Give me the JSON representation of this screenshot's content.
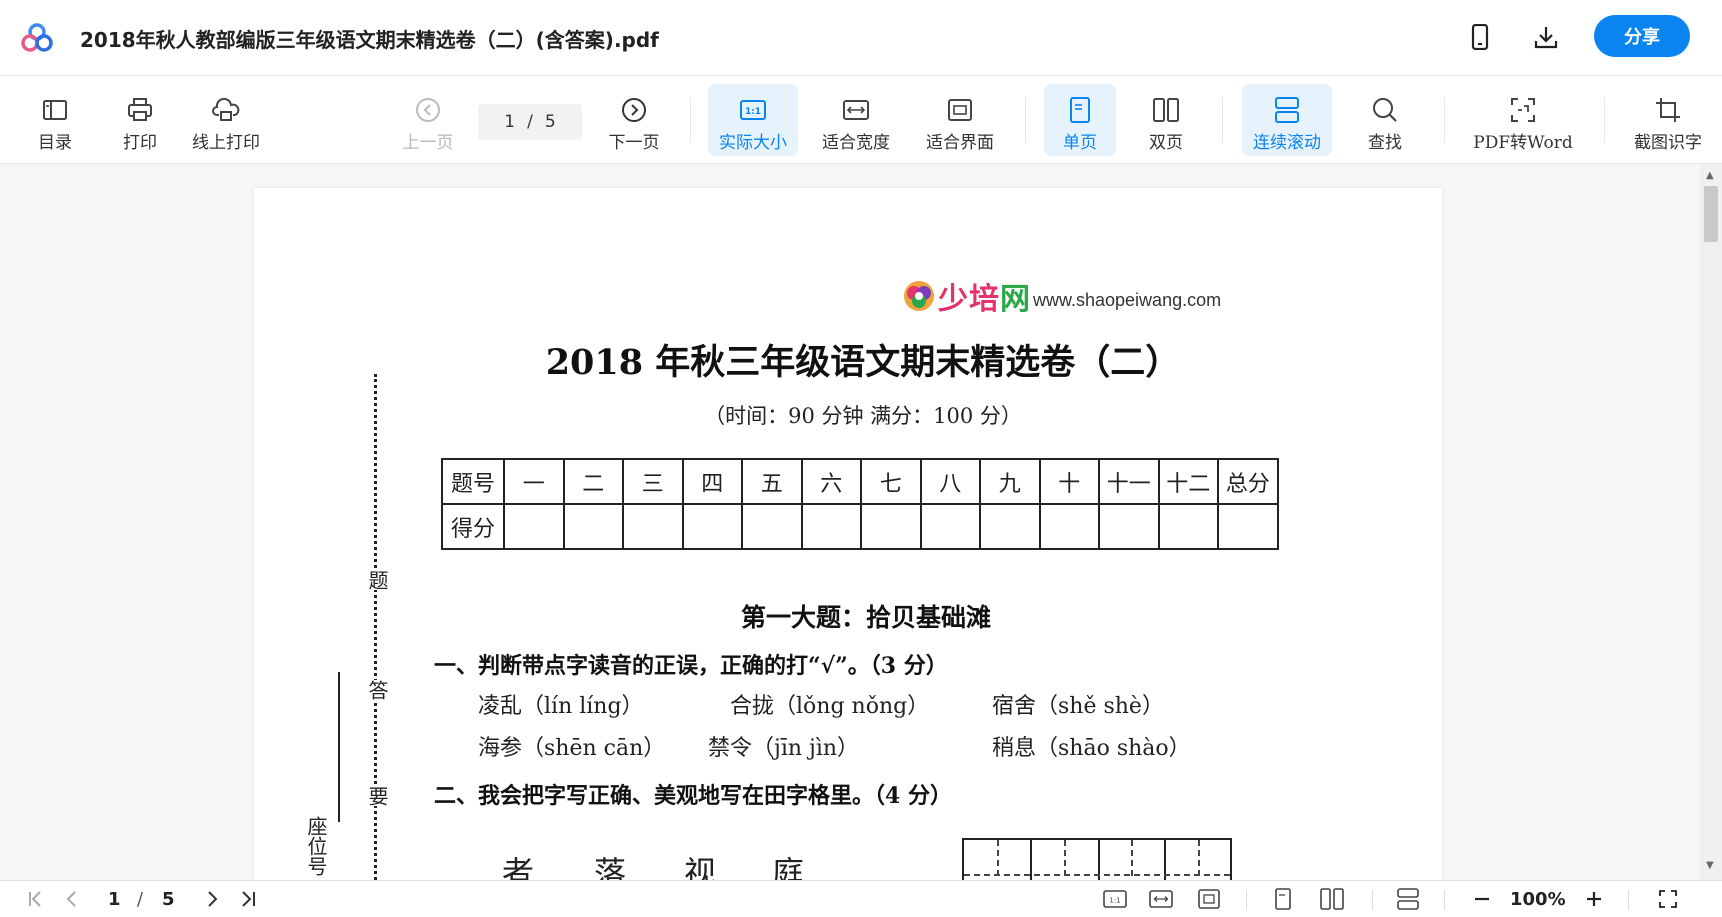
{
  "title_bar": {
    "doc_title": "2018年秋人教部编版三年级语文期末精选卷（二）(含答案).pdf",
    "share_label": "分享"
  },
  "toolbar": {
    "toc": "目录",
    "print": "打印",
    "online_print": "线上打印",
    "prev_page": "上一页",
    "page_current": "1",
    "page_sep": "/",
    "page_total": "5",
    "next_page": "下一页",
    "actual_size": "实际大小",
    "fit_width": "适合宽度",
    "fit_screen": "适合界面",
    "single_page": "单页",
    "double_page": "双页",
    "continuous_scroll": "连续滚动",
    "find": "查找",
    "pdf_to_word": "PDF转Word",
    "screenshot_ocr": "截图识字"
  },
  "document": {
    "brand_cn_1": "少培",
    "brand_cn_2": "网",
    "brand_url": "www.shaopeiwang.com",
    "exam_title": "2018 年秋三年级语文期末精选卷（二）",
    "exam_subtitle": "（时间：90 分钟   满分：100 分）",
    "score_table": {
      "row1": [
        "题号",
        "一",
        "二",
        "三",
        "四",
        "五",
        "六",
        "七",
        "八",
        "九",
        "十",
        "十一",
        "十二",
        "总分"
      ],
      "row2_label": "得分"
    },
    "section_title": "第一大题：拾贝基础滩",
    "q1": "一、判断带点字读音的正误，正确的打“√”。（3 分）",
    "q1_items": [
      "凌乱（lín  líng）",
      "合拢（lǒng  nǒng）",
      "宿舍（shě  shè）",
      "海参（shēn  cān）",
      "禁令（jīn  jìn）",
      "稍息（shāo  shào）"
    ],
    "q2": "二、我会把字写正确、美观地写在田字格里。（4 分）",
    "q2_chars": [
      "者",
      "落",
      "视",
      "庭"
    ],
    "side_chars": [
      "题",
      "答",
      "要"
    ],
    "side_label": "座位号"
  },
  "status_bar": {
    "page_current": "1",
    "page_sep": "/",
    "page_total": "5",
    "zoom": "100%"
  },
  "colors": {
    "accent": "#0a84f0",
    "active_bg": "#e6f3fd",
    "brand_pink": "#e2336c",
    "brand_green": "#2ca84a"
  },
  "icons": [
    "cloud-logo-icon",
    "phone-icon",
    "download-icon",
    "toc-icon",
    "print-icon",
    "cloud-print-icon",
    "prev-circle-icon",
    "next-circle-icon",
    "actual-size-icon",
    "fit-width-icon",
    "fit-screen-icon",
    "single-page-icon",
    "double-page-icon",
    "continuous-scroll-icon",
    "search-icon",
    "pdf-to-word-icon",
    "crop-ocr-icon",
    "first-page-icon",
    "prev-page-icon",
    "next-page-icon",
    "last-page-icon",
    "zoom-out-icon",
    "zoom-in-icon",
    "fullscreen-icon"
  ]
}
